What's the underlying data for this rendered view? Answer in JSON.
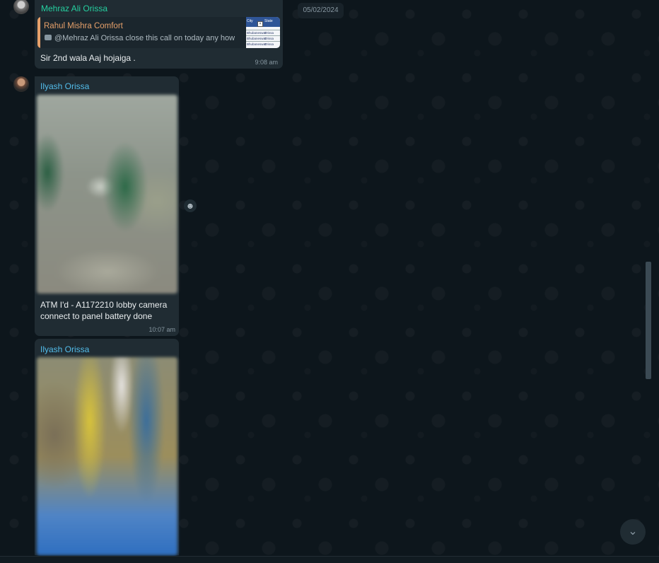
{
  "chat": {
    "date_chip": "05/02/2024",
    "messages": [
      {
        "sender": "Mehraz Ali Orissa",
        "quote": {
          "author": "Rahul Mishra Comfort",
          "text": "@Mehraz Ali Orissa close this call on today any how",
          "thumb": {
            "col_city": "City",
            "col_state": "State",
            "rows": [
              {
                "city": "Bhubaneswar",
                "state": "Orissa"
              },
              {
                "city": "Bhubaneswar",
                "state": "Orissa"
              },
              {
                "city": "Bhubaneswar",
                "state": "Orissa"
              }
            ]
          }
        },
        "text": "Sir 2nd wala Aaj hojaiga .",
        "time": "9:08 am"
      },
      {
        "sender": "Ilyash Orissa",
        "text": "ATM I'd - A1172210 lobby camera connect to panel battery done",
        "time": "10:07 am"
      },
      {
        "sender": "Ilyash Orissa"
      }
    ]
  },
  "icons": {
    "reaction": "emoji-icon",
    "scroll_down": "chevron-down-icon"
  },
  "colors": {
    "background": "#0b141a",
    "bubble": "#202c33",
    "sender_green": "#25d0a0",
    "sender_blue": "#53bdeb",
    "quote_author": "#e6a06a"
  }
}
